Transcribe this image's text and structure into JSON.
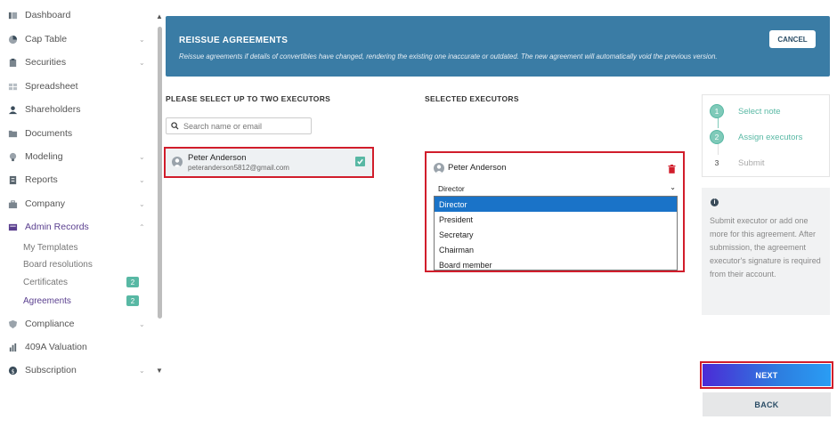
{
  "sidebar": {
    "items": [
      {
        "label": "Dashboard",
        "icon": "dashboard-icon",
        "chevron": false
      },
      {
        "label": "Cap Table",
        "icon": "pie-chart-icon",
        "chevron": true
      },
      {
        "label": "Securities",
        "icon": "clipboard-icon",
        "chevron": true
      },
      {
        "label": "Spreadsheet",
        "icon": "spreadsheet-icon",
        "chevron": false
      },
      {
        "label": "Shareholders",
        "icon": "person-icon",
        "chevron": false
      },
      {
        "label": "Documents",
        "icon": "folder-icon",
        "chevron": false
      },
      {
        "label": "Modeling",
        "icon": "lightbulb-icon",
        "chevron": true
      },
      {
        "label": "Reports",
        "icon": "report-icon",
        "chevron": true
      },
      {
        "label": "Company",
        "icon": "briefcase-icon",
        "chevron": true
      },
      {
        "label": "Admin Records",
        "icon": "records-icon",
        "chevron": true
      },
      {
        "label": "Compliance",
        "icon": "shield-icon",
        "chevron": true
      },
      {
        "label": "409A Valuation",
        "icon": "valuation-icon",
        "chevron": false
      },
      {
        "label": "Subscription",
        "icon": "dollar-icon",
        "chevron": true
      }
    ],
    "admin_sub": [
      {
        "label": "My Templates"
      },
      {
        "label": "Board resolutions"
      },
      {
        "label": "Certificates",
        "badge": "2"
      },
      {
        "label": "Agreements",
        "badge": "2"
      }
    ]
  },
  "banner": {
    "title": "REISSUE AGREEMENTS",
    "subtitle": "Reissue agreements if details of convertibles have changed, rendering the existing one inaccurate or outdated. The new agreement will automatically void the previous version.",
    "cancel_label": "CANCEL"
  },
  "left": {
    "title": "PLEASE SELECT UP TO TWO EXECUTORS",
    "search_placeholder": "Search name or email",
    "executor": {
      "name": "Peter Anderson",
      "email": "peteranderson5812@gmail.com"
    }
  },
  "right": {
    "title": "SELECTED EXECUTORS",
    "selected": {
      "name": "Peter Anderson",
      "role": "Director"
    },
    "options": [
      "Director",
      "President",
      "Secretary",
      "Chairman",
      "Board member"
    ]
  },
  "steps": [
    {
      "num": "1",
      "label": "Select note",
      "state": "done"
    },
    {
      "num": "2",
      "label": "Assign executors",
      "state": "done"
    },
    {
      "num": "3",
      "label": "Submit",
      "state": "todo"
    }
  ],
  "info": {
    "text": "Submit executor or add one more for this agreement. After submission, the agreement executor's signature is required from their account."
  },
  "buttons": {
    "next": "NEXT",
    "back": "BACK"
  },
  "colors": {
    "accent": "#58b8a4",
    "banner": "#3a7ca5",
    "highlight": "#d11d2b",
    "active_nav": "#5a3f8f"
  }
}
